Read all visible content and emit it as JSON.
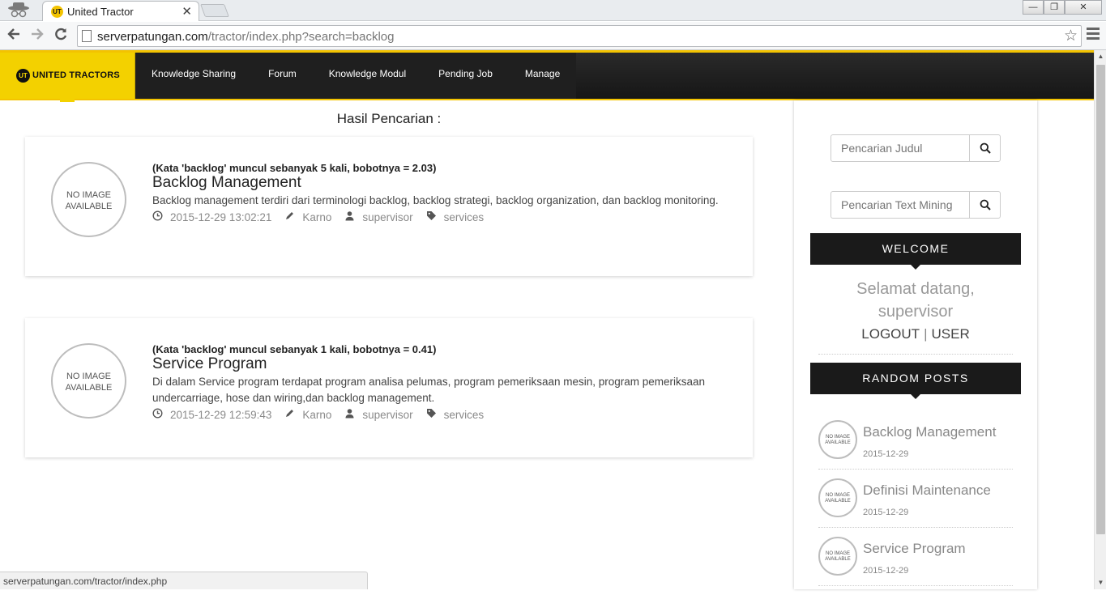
{
  "browser": {
    "tab_title": "United Tractor",
    "tab_close": "✕",
    "url_domain": "serverpatungan.com",
    "url_path": "/tractor/index.php?search=backlog",
    "status_url": "serverpatungan.com/tractor/index.php",
    "window_controls": [
      "—",
      "❐",
      "✕"
    ]
  },
  "navbar": {
    "brand": "UNITED TRACTORS",
    "brand_logo": "UT",
    "items": [
      "Knowledge Sharing",
      "Forum",
      "Knowledge Modul",
      "Pending Job",
      "Manage"
    ]
  },
  "main": {
    "heading": "Hasil Pencarian :",
    "no_image_text": [
      "NO IMAGE",
      "AVAILABLE"
    ],
    "results": [
      {
        "note": "(Kata 'backlog' muncul sebanyak 5 kali, bobotnya = 2.03)",
        "title": "Backlog Management",
        "description": "Backlog management terdiri dari terminologi backlog, backlog strategi, backlog organization, dan backlog monitoring.",
        "date": "2015-12-29 13:02:21",
        "author": "Karno",
        "role": "supervisor",
        "category": "services"
      },
      {
        "note": "(Kata 'backlog' muncul sebanyak 1 kali, bobotnya = 0.41)",
        "title": "Service Program",
        "description": "Di dalam Service program terdapat program analisa pelumas, program pemeriksaan mesin, program pemeriksaan undercarriage, hose dan wiring,dan backlog management.",
        "date": "2015-12-29 12:59:43",
        "author": "Karno",
        "role": "supervisor",
        "category": "services"
      }
    ]
  },
  "sidebar": {
    "search_title_placeholder": "Pencarian Judul",
    "search_text_placeholder": "Pencarian Text Mining",
    "welcome_title": "WELCOME",
    "welcome_line1": "Selamat datang,",
    "welcome_line2": "supervisor",
    "logout": "LOGOUT",
    "separator": "|",
    "user": "USER",
    "random_title": "RANDOM POSTS",
    "random_posts": [
      {
        "title": "Backlog Management",
        "date": "2015-12-29"
      },
      {
        "title": "Definisi Maintenance",
        "date": "2015-12-29"
      },
      {
        "title": "Service Program",
        "date": "2015-12-29"
      }
    ]
  },
  "icons": {
    "clock": "clock-icon",
    "pencil": "pencil-icon",
    "user": "user-icon",
    "tag": "tag-icon",
    "search": "search-icon"
  },
  "colors": {
    "brand_yellow": "#f3d100",
    "nav_dark": "#1f1f1f",
    "widget_dark": "#1a1a1a"
  }
}
